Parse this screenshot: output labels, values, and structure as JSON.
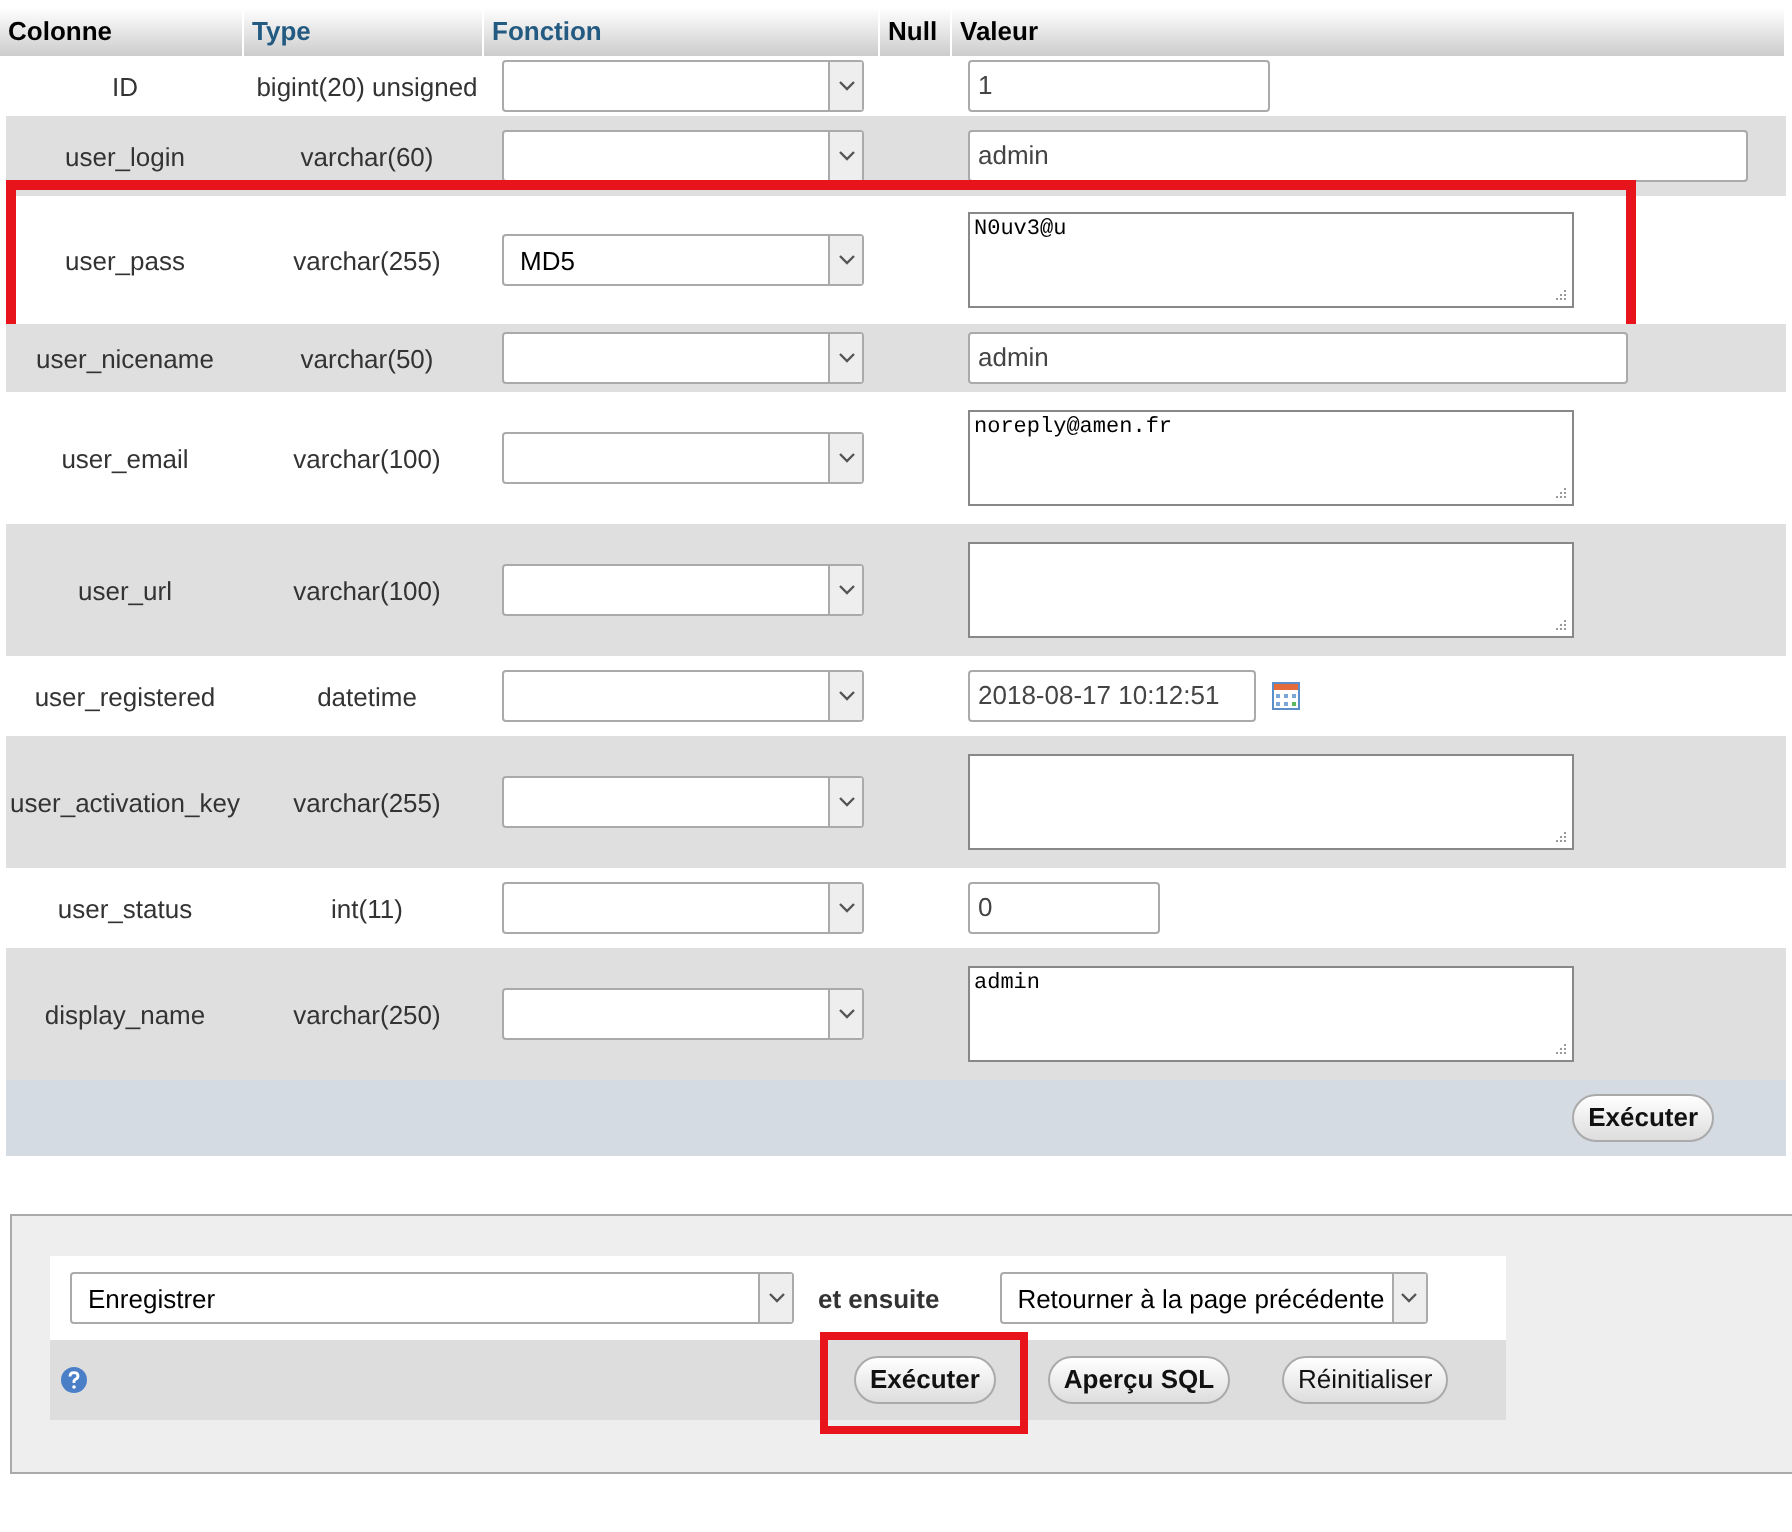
{
  "table": {
    "columns": [
      "Colonne",
      "Type",
      "Fonction",
      "Null",
      "Valeur"
    ],
    "rows": [
      {
        "column": "ID",
        "type": "bigint(20) unsigned",
        "function": "",
        "kind": "short-input",
        "value": "1",
        "highlighted": false
      },
      {
        "column": "user_login",
        "type": "varchar(60)",
        "function": "",
        "kind": "wide-input",
        "value": "admin",
        "highlighted": false
      },
      {
        "column": "user_pass",
        "type": "varchar(255)",
        "function": "MD5",
        "kind": "textarea",
        "value": "N0uv3@u",
        "highlighted": true
      },
      {
        "column": "user_nicename",
        "type": "varchar(50)",
        "function": "",
        "kind": "medium-input",
        "value": "admin",
        "highlighted": false
      },
      {
        "column": "user_email",
        "type": "varchar(100)",
        "function": "",
        "kind": "textarea",
        "value": "noreply@amen.fr",
        "highlighted": false
      },
      {
        "column": "user_url",
        "type": "varchar(100)",
        "function": "",
        "kind": "textarea",
        "value": "",
        "highlighted": false
      },
      {
        "column": "user_registered",
        "type": "datetime",
        "function": "",
        "kind": "date-input",
        "value": "2018-08-17 10:12:51",
        "highlighted": false
      },
      {
        "column": "user_activation_key",
        "type": "varchar(255)",
        "function": "",
        "kind": "textarea",
        "value": "",
        "highlighted": false
      },
      {
        "column": "user_status",
        "type": "int(11)",
        "function": "",
        "kind": "tiny-input",
        "value": "0",
        "highlighted": false
      },
      {
        "column": "display_name",
        "type": "varchar(250)",
        "function": "",
        "kind": "textarea",
        "value": "admin",
        "highlighted": false
      }
    ],
    "submit_button": "Exécuter"
  },
  "footer": {
    "action": "Enregistrer",
    "then_label": "et ensuite",
    "after": "Retourner à la page précédente",
    "buttons": [
      {
        "label": "Exécuter",
        "bold": true,
        "highlighted": true
      },
      {
        "label": "Aperçu SQL",
        "bold": true,
        "highlighted": false
      },
      {
        "label": "Réinitialiser",
        "bold": false,
        "highlighted": false
      }
    ]
  }
}
